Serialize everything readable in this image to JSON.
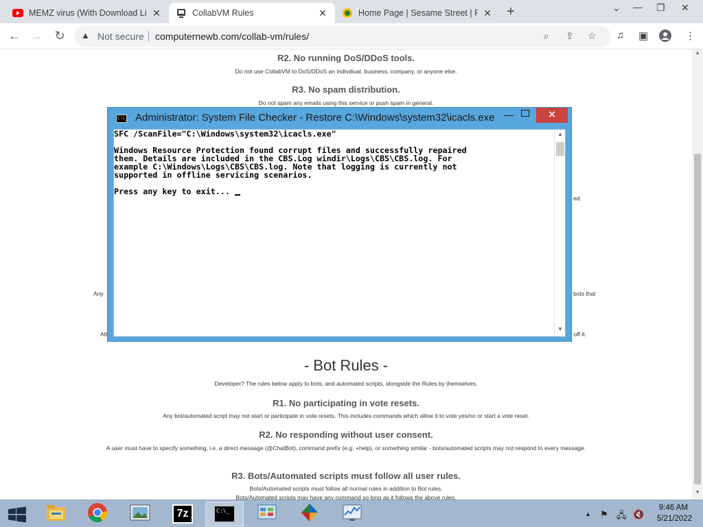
{
  "browser": {
    "tabs": [
      {
        "title": "MEMZ virus (With Download Link",
        "favicon": "youtube-icon"
      },
      {
        "title": "CollabVM Rules",
        "favicon": "collabvm-icon"
      },
      {
        "title": "Home Page | Sesame Street | PBS",
        "favicon": "sesame-street-icon"
      }
    ],
    "active_tab": 1,
    "security_label": "Not secure",
    "url": "computernewb.com/collab-vm/rules/"
  },
  "page": {
    "r2_heading": "R2. No running DoS/DDoS tools.",
    "r2_text": "Do not use CollabVM to DoS/DDoS an indivdiual, business, company, or anyone else.",
    "r3_heading": "R3. No spam distribution.",
    "r3_text": "Do not spam any emails using this service or push spam in general.",
    "frag_ed": "ed.",
    "frag_any": "Any",
    "frag_bots_that": "bots that",
    "frag_att": "Att",
    "frag_off_it": "y off it.",
    "bot_rules_heading": "- Bot Rules -",
    "bot_rules_intro": "Developer? The rules below apply to bots, and automated scripts, alongside the Rules by themselves.",
    "b1_heading": "R1. No participating in vote resets.",
    "b1_text": "Any bot/automated script may not start or participate in vote resets. This includes commands which allow it to vote yes/no or start a vote reset.",
    "b2_heading": "R2. No responding without user consent.",
    "b2_text": "A user must have to specify something, i.e. a direct message (@ChatBot), command prefix (e.g. +help), or something similar - bots/automated scripts may not respond to every message.",
    "b3_heading": "R3. Bots/Automated scripts must follow all user rules.",
    "b3_text1": "Bots/Automated scripts must follow all normal rules in addition to Bot rules.",
    "b3_text2": "Bots/Automated scripts may have any command so long as it follows the above rules."
  },
  "cmd": {
    "title": "Administrator:  System File Checker - Restore C:\\Windows\\system32\\icacls.exe",
    "icon_text": "C:\\_",
    "lines": [
      "SFC /ScanFile=\"C:\\Windows\\system32\\icacls.exe\"",
      "",
      "Windows Resource Protection found corrupt files and successfully repaired",
      "them. Details are included in the CBS.Log windir\\Logs\\CBS\\CBS.log. For",
      "example C:\\Windows\\Logs\\CBS\\CBS.log. Note that logging is currently not",
      "supported in offline servicing scenarios.",
      "",
      "Press any key to exit... "
    ]
  },
  "taskbar": {
    "time": "9:46 AM",
    "date": "5/21/2022",
    "apps": [
      "file-explorer-icon",
      "chrome-icon",
      "photos-icon",
      "7zip-icon",
      "cmd-icon",
      "control-panel-icon",
      "games-icon",
      "resource-monitor-icon"
    ],
    "app_7zip_label": "7z",
    "app_cmd_label": "C:\\_"
  }
}
